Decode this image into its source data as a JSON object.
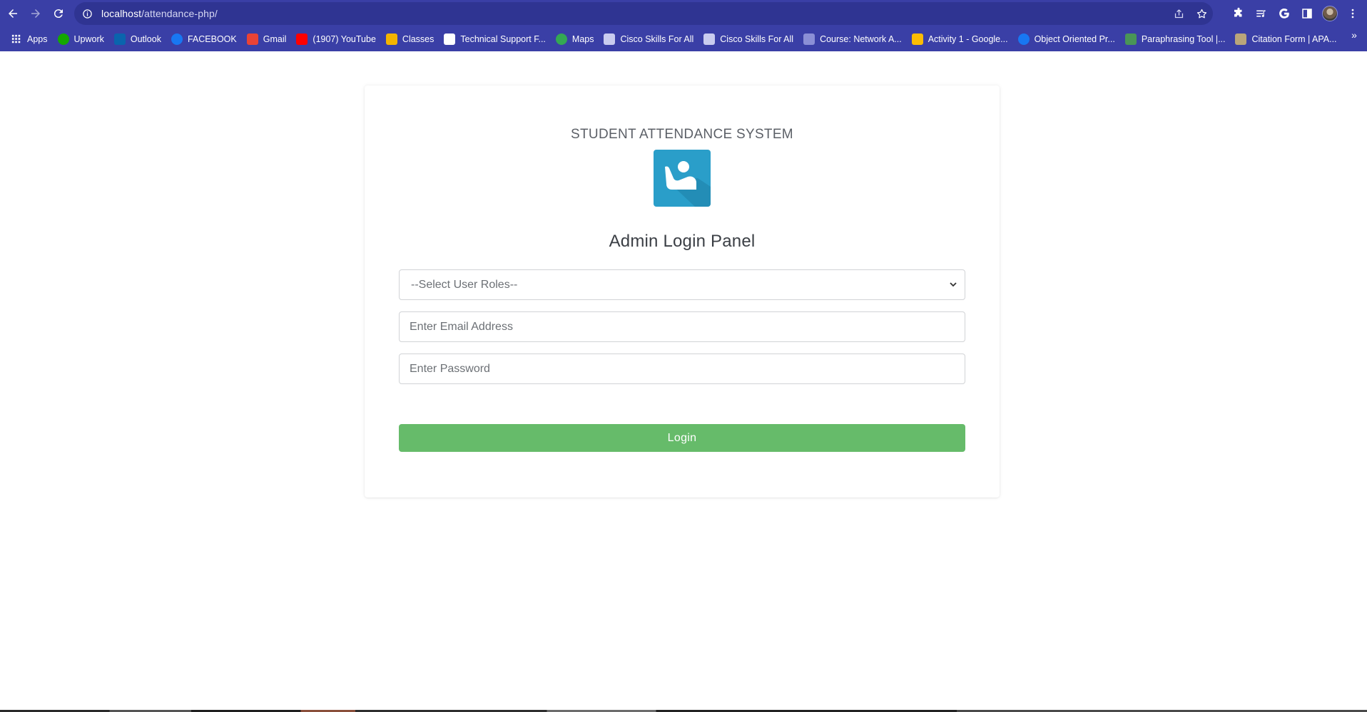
{
  "browser": {
    "url_host": "localhost",
    "url_path": "/attendance-php/",
    "bookmarks": [
      {
        "label": "Apps",
        "icon": "apps-grid-icon",
        "color": "#ffffff"
      },
      {
        "label": "Upwork",
        "icon": "upwork-icon",
        "color": "#14a800"
      },
      {
        "label": "Outlook",
        "icon": "outlook-icon",
        "color": "#0a64ad"
      },
      {
        "label": "FACEBOOK",
        "icon": "facebook-icon",
        "color": "#1877f2"
      },
      {
        "label": "Gmail",
        "icon": "gmail-icon",
        "color": "#ea4335"
      },
      {
        "label": "(1907) YouTube",
        "icon": "youtube-icon",
        "color": "#ff0000"
      },
      {
        "label": "Classes",
        "icon": "classroom-icon",
        "color": "#f4b400"
      },
      {
        "label": "Technical Support F...",
        "icon": "c-logo-icon",
        "color": "#ffffff"
      },
      {
        "label": "Maps",
        "icon": "maps-pin-icon",
        "color": "#34a853"
      },
      {
        "label": "Cisco Skills For All",
        "icon": "cisco-icon",
        "color": "#c9ccef"
      },
      {
        "label": "Cisco Skills For All",
        "icon": "cisco-icon",
        "color": "#c9ccef"
      },
      {
        "label": "Course: Network A...",
        "icon": "course-icon",
        "color": "#8b8fd6"
      },
      {
        "label": "Activity 1 - Google...",
        "icon": "google-drive-icon",
        "color": "#fbbc04"
      },
      {
        "label": "Object Oriented Pr...",
        "icon": "facebook-icon",
        "color": "#1877f2"
      },
      {
        "label": "Paraphrasing Tool |...",
        "icon": "quillbot-icon",
        "color": "#499557"
      },
      {
        "label": "Citation Form | APA...",
        "icon": "citation-icon",
        "color": "#b9a57a"
      }
    ]
  },
  "page": {
    "system_title": "STUDENT ATTENDANCE SYSTEM",
    "panel_title": "Admin Login Panel",
    "role_select_value": "--Select User Roles--",
    "email_placeholder": "Enter Email Address",
    "password_placeholder": "Enter Password",
    "login_label": "Login",
    "colors": {
      "login_button": "#66bb6a",
      "logo_background": "#2a9ec9",
      "browser_chrome": "#3a3fa6"
    }
  }
}
